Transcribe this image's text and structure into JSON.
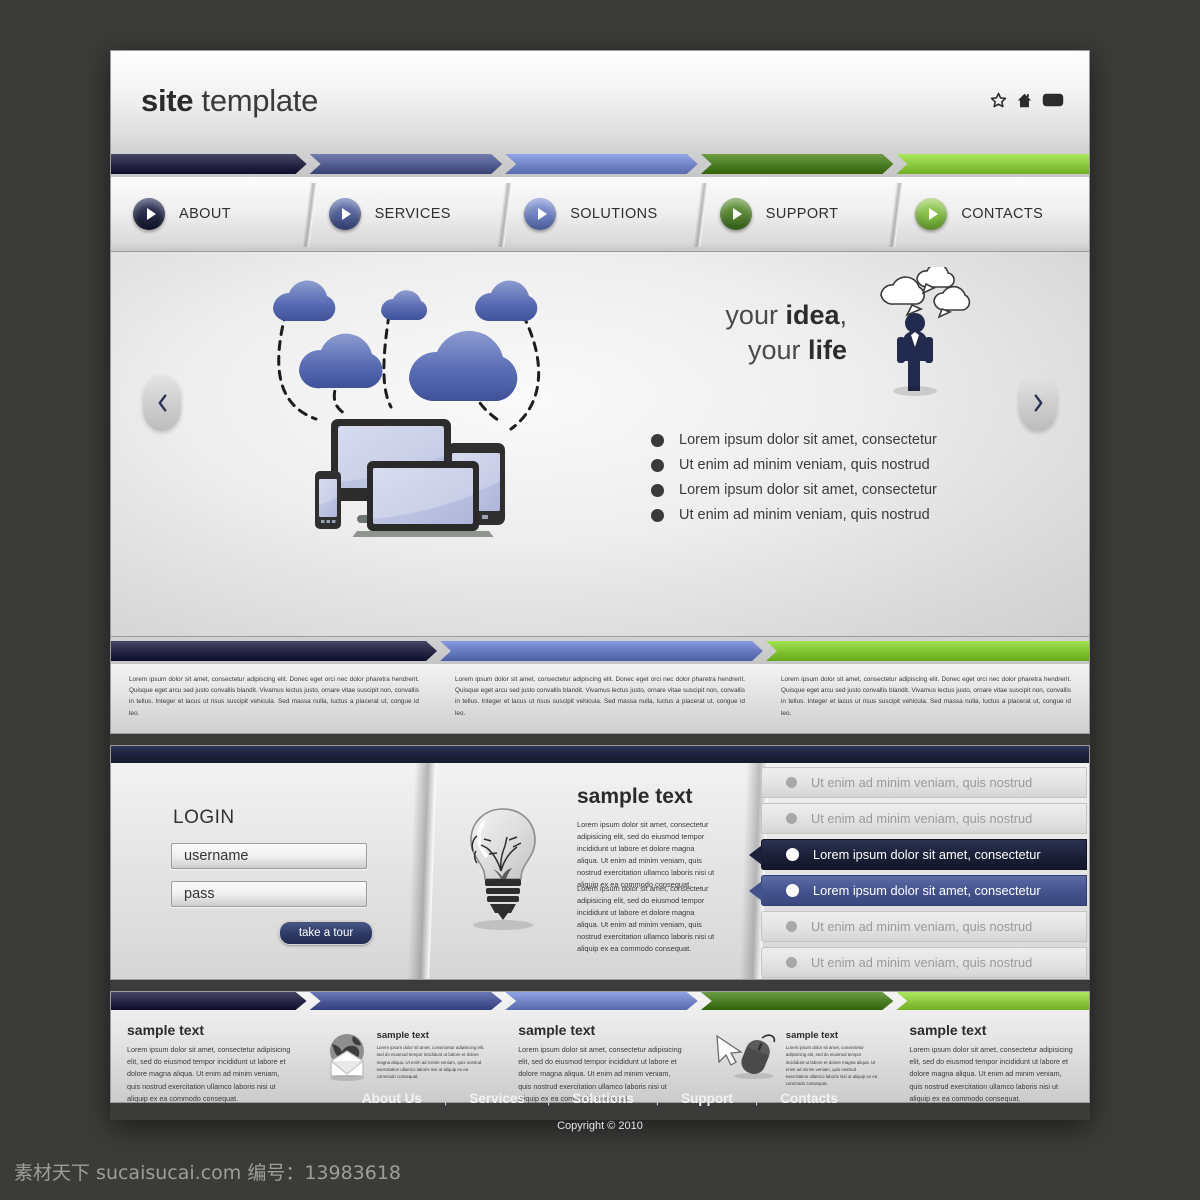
{
  "site": {
    "logo_bold": "site",
    "logo_light": " template",
    "header_icons": [
      "star-icon",
      "home-icon",
      "screen-icon"
    ]
  },
  "ribbon_colors": [
    "#242443",
    "#515b8d",
    "#7083c4",
    "#4b7b23",
    "#8bc63f"
  ],
  "nav": {
    "items": [
      {
        "label": "ABOUT",
        "color_top": "#3d4268",
        "color_bot": "#14162b"
      },
      {
        "label": "SERVICES",
        "color_top": "#6d7cb4",
        "color_bot": "#3a4880"
      },
      {
        "label": "SOLUTIONS",
        "color_top": "#8a9bd4",
        "color_bot": "#5a6db4"
      },
      {
        "label": "SUPPORT",
        "color_top": "#6f9e49",
        "color_bot": "#3f6d1e"
      },
      {
        "label": "CONTACTS",
        "color_top": "#a5d46a",
        "color_bot": "#6cab31"
      }
    ]
  },
  "hero": {
    "prev_label": "‹",
    "next_label": "›",
    "heading_line1_light": "your ",
    "heading_line1_bold": "idea",
    "heading_line1_tail": ",",
    "heading_line2_light": "your ",
    "heading_line2_bold": "life",
    "bullets": [
      "Lorem ipsum dolor sit amet, consectetur",
      "Ut enim ad minim veniam, quis nostrud",
      "Lorem ipsum dolor sit amet, consectetur",
      "Ut enim ad minim veniam, quis nostrud"
    ]
  },
  "info_strip": {
    "ribbon_colors": [
      "#242443",
      "#6578bd",
      "#7fc131"
    ],
    "paragraph": "Lorem ipsum dolor sit amet, consectetur adipiscing elit. Donec eget orci nec dolor pharetra hendrerit. Quisque eget arcu sed justo convallis blandit. Vivamus lectus justo, ornare vitae suscipit non, convallis in tellus. Integer et lacus ut risus suscipit vehicula. Sed massa nulla, luctus a placerat ut, congue id leo.",
    "columns": 3
  },
  "login": {
    "title": "LOGIN",
    "username_value": "username",
    "username_placeholder": "username",
    "password_value": "pass",
    "password_placeholder": "pass",
    "button_label": "take a tour"
  },
  "sample_block": {
    "title": "sample text",
    "paragraph1": "Lorem ipsum dolor sit amet, consectetur adipisicing elit, sed do eiusmod tempor incididunt ut labore et dolore magna aliqua. Ut enim ad minim veniam, quis nostrud exercitation ullamco laboris nisi ut aliquip ex ea commodo consequat.",
    "paragraph2": "Lorem ipsum dolor sit amet, consectetur adipisicing elit, sed do eiusmod tempor incididunt ut labore et dolore magna aliqua. Ut enim ad minim veniam, quis nostrud exercitation ullamco laboris nisi ut aliquip ex ea commodo consequat.",
    "icon": "lightbulb-icon"
  },
  "feature_list": {
    "items": [
      {
        "label": "Ut enim ad minim veniam, quis nostrud",
        "state": "off"
      },
      {
        "label": "Ut enim ad minim veniam, quis nostrud",
        "state": "off"
      },
      {
        "label": "Lorem ipsum dolor sit amet, consectetur",
        "state": "on-dark"
      },
      {
        "label": "Lorem ipsum dolor sit amet, consectetur",
        "state": "on-blue"
      },
      {
        "label": "Ut enim ad minim veniam, quis nostrud",
        "state": "off"
      },
      {
        "label": "Ut enim ad minim veniam, quis nostrud",
        "state": "off"
      }
    ]
  },
  "footer_columns": {
    "ribbon_colors": [
      "#242443",
      "#4a5696",
      "#6f82c4",
      "#4b7b23",
      "#8bc63f"
    ],
    "big_paragraph": "Lorem ipsum dolor sit amet, consectetur adipisicing elit, sed do eiusmod tempor incididunt ut labore et dolore magna aliqua. Ut enim ad minim veniam, quis nostrud exercitation ullamco laboris nisi ut aliquip ex ea commodo consequat.",
    "small_paragraph": "Lorem ipsum dolor sit amet, consectetur adipisicing elit, sed do eiusmod tempor incididunt ut labore et dolore magna aliqua. Ut enim ad minim veniam, quis nostrud exercitation ullamco laboris nisi ut aliquip ex ea commodo consequat.",
    "cols": [
      {
        "title": "sample text",
        "kind": "big",
        "icon": ""
      },
      {
        "title": "sample text",
        "kind": "mini",
        "icon": "globe-envelope-icon"
      },
      {
        "title": "sample text",
        "kind": "big",
        "icon": ""
      },
      {
        "title": "sample text",
        "kind": "mini",
        "icon": "mouse-cursor-icon"
      },
      {
        "title": "sample text",
        "kind": "big",
        "icon": ""
      }
    ]
  },
  "bottom_nav": {
    "links": [
      "About Us",
      "Services",
      "Solutions",
      "Support",
      "Contacts"
    ],
    "separator": "|",
    "copyright": "Copyright © 2010"
  },
  "watermark": "素材天下 sucaisucai.com 编号：13983618"
}
